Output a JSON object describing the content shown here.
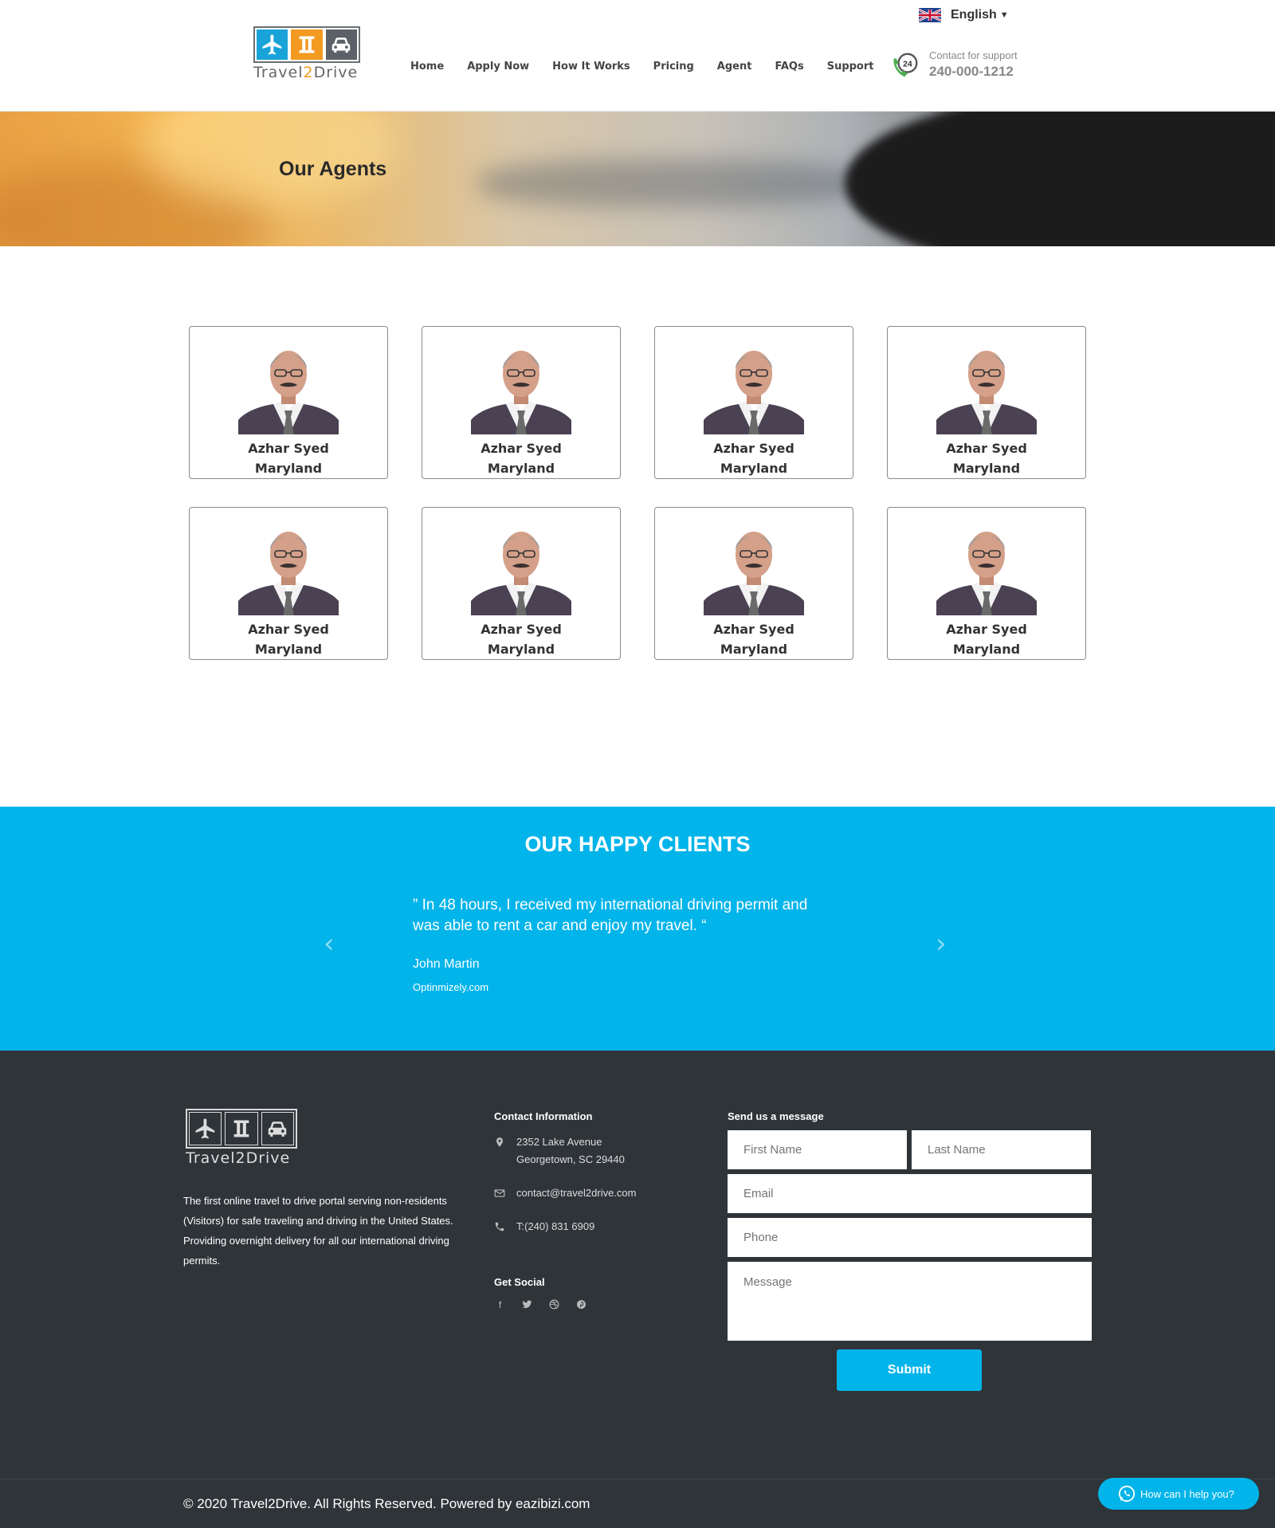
{
  "header": {
    "logo_text_a": "Travel",
    "logo_text_b": "2",
    "logo_text_c": "Drive",
    "nav": [
      "Home",
      "Apply Now",
      "How It Works",
      "Pricing",
      "Agent",
      "FAQs",
      "Support"
    ],
    "language": "English",
    "support_label": "Contact for support",
    "support_phone": "240-000-1212",
    "support_badge": "24"
  },
  "hero": {
    "title": "Our Agents"
  },
  "agents": [
    {
      "name": "Azhar Syed",
      "location": "Maryland"
    },
    {
      "name": "Azhar Syed",
      "location": "Maryland"
    },
    {
      "name": "Azhar Syed",
      "location": "Maryland"
    },
    {
      "name": "Azhar Syed",
      "location": "Maryland"
    },
    {
      "name": "Azhar Syed",
      "location": "Maryland"
    },
    {
      "name": "Azhar Syed",
      "location": "Maryland"
    },
    {
      "name": "Azhar Syed",
      "location": "Maryland"
    },
    {
      "name": "Azhar Syed",
      "location": "Maryland"
    }
  ],
  "testimonials": {
    "title": "OUR HAPPY CLIENTS",
    "quote": "” In 48 hours, I received my international driving permit and was able to rent a car and enjoy my travel. “",
    "author": "John Martin",
    "site": "Optinmizely.com",
    "prev_icon": "chevron-left-icon",
    "next_icon": "chevron-right-icon"
  },
  "footer": {
    "about": "The first online travel to drive portal serving non-residents (Visitors) for safe traveling and driving in the United States. Providing overnight delivery for all our international driving permits.",
    "contact_heading": "Contact Information",
    "address_line1": "2352 Lake Avenue",
    "address_line2": "Georgetown, SC 29440",
    "email": "contact@travel2drive.com",
    "phone": "T:(240) 831 6909",
    "social_heading": "Get Social",
    "social_icons": [
      "facebook-icon",
      "twitter-icon",
      "dribbble-icon",
      "pinterest-icon"
    ],
    "form_heading": "Send us a message",
    "form": {
      "first_name_placeholder": "First Name",
      "last_name_placeholder": "Last Name",
      "email_placeholder": "Email",
      "phone_placeholder": "Phone",
      "message_placeholder": "Message",
      "submit_label": "Submit"
    },
    "copyright": "© 2020 Travel2Drive. All Rights Reserved. Powered by eazibizi.com"
  },
  "whatsapp": {
    "label": "How can I help you?"
  },
  "colors": {
    "brand_blue": "#01b4ea",
    "brand_orange": "#f39a21",
    "footer_bg": "#2f3439"
  }
}
